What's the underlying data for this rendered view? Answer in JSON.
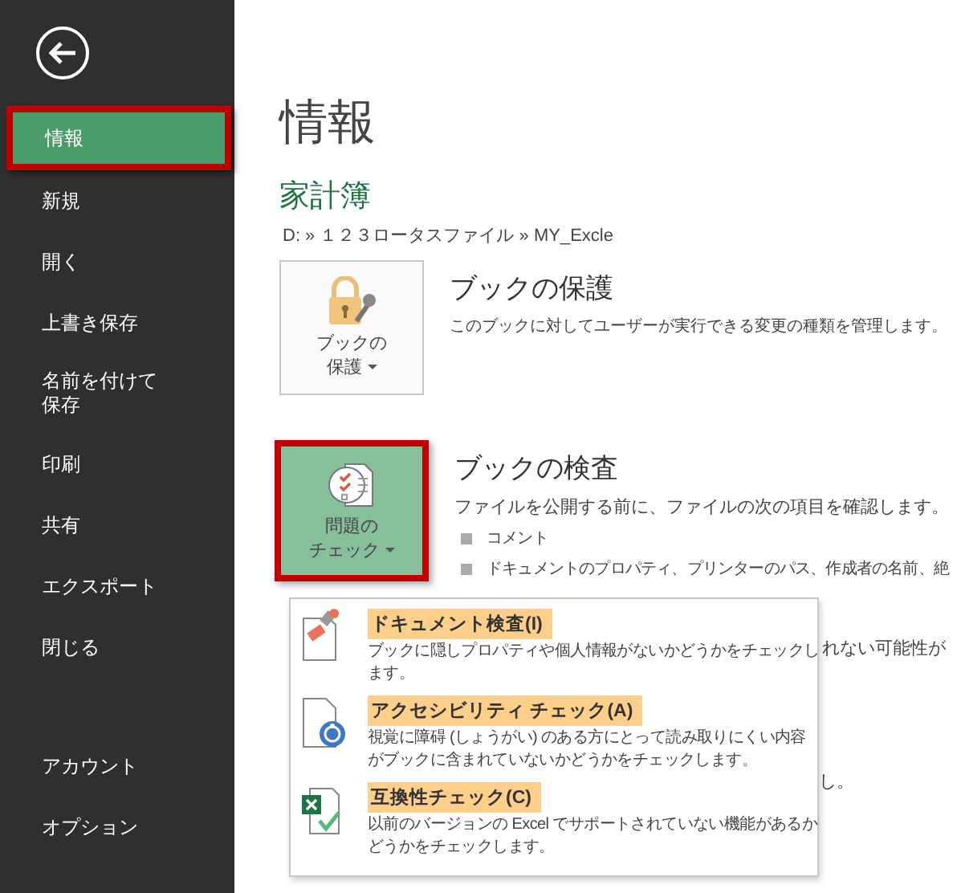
{
  "sidebar": {
    "items": [
      {
        "label": "情報",
        "selected": true
      },
      {
        "label": "新規",
        "selected": false
      },
      {
        "label": "開く",
        "selected": false
      },
      {
        "label": "上書き保存",
        "selected": false
      },
      {
        "label": "名前を付けて保存",
        "selected": false
      },
      {
        "label": "印刷",
        "selected": false
      },
      {
        "label": "共有",
        "selected": false
      },
      {
        "label": "エクスポート",
        "selected": false
      },
      {
        "label": "閉じる",
        "selected": false
      }
    ],
    "bottom_items": [
      {
        "label": "アカウント",
        "selected": false
      },
      {
        "label": "オプション",
        "selected": false
      }
    ]
  },
  "page_title": "情報",
  "file_name": "家計簿",
  "file_path": "D: » １２３ロータスファイル » MY_Excle",
  "sections": [
    {
      "kind": "protect",
      "button_label_lines": [
        "ブックの",
        "保護"
      ],
      "selected": false,
      "heading": "ブックの保護",
      "description": "このブックに対してユーザーが実行できる変更の種類を管理します。"
    },
    {
      "kind": "inspect",
      "button_label_lines": [
        "問題の",
        "チェック"
      ],
      "selected": true,
      "heading": "ブックの検査",
      "description": "ファイルを公開する前に、ファイルの次の項目を確認します。",
      "bullets": [
        "コメント",
        "ドキュメントのプロパティ、プリンターのパス、作成者の名前、絶"
      ]
    }
  ],
  "hidden_fragments": [
    "れない可能性が",
    "し。"
  ],
  "menu": {
    "items": [
      {
        "kind": "document",
        "title": "ドキュメント検査(I)",
        "description": "ブックに隠しプロパティや個人情報がないかどうかをチェックします。"
      },
      {
        "kind": "accessibility",
        "title": "アクセシビリティ チェック(A)",
        "description": "視覚に障碍 (しょうがい) のある方にとって読み取りにくい内容がブックに含まれていないかどうかをチェックします。"
      },
      {
        "kind": "compat",
        "title": "互換性チェック(C)",
        "description": "以前のバージョンの Excel でサポートされていない機能があるかどうかをチェックします。"
      }
    ]
  }
}
